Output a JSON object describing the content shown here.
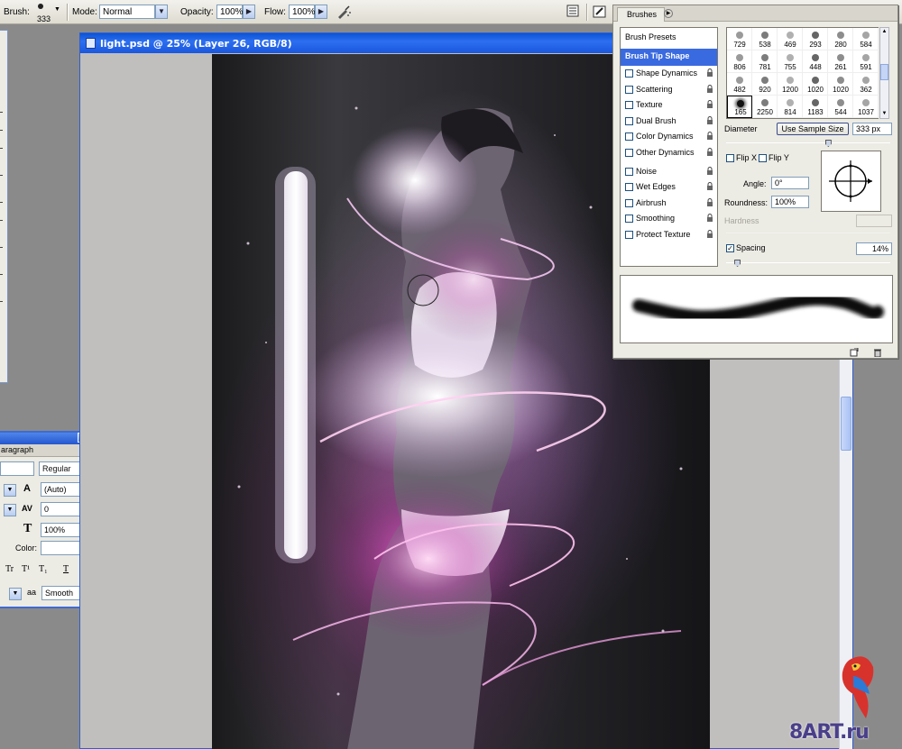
{
  "options_bar": {
    "brush_label": "Brush:",
    "brush_size": "333",
    "mode_label": "Mode:",
    "mode_value": "Normal",
    "opacity_label": "Opacity:",
    "opacity_value": "100%",
    "flow_label": "Flow:",
    "flow_value": "100%",
    "airbrush_icon": "airbrush-icon",
    "palette_icon": "palette-well-icon",
    "brush_panel_icon": "toggle-brushes-icon"
  },
  "paragraph_panel": {
    "tab_label": "aragraph",
    "font_style": "Regular",
    "leading": "(Auto)",
    "tracking": "0",
    "vertical_scale": "100%",
    "color_label": "Color:",
    "antialias": "Smooth",
    "antialias_prefix": "aa",
    "style_buttons": [
      "Tr",
      "T¹",
      "T₁",
      "T",
      "Ŧ"
    ]
  },
  "document": {
    "title": "light.psd @ 25% (Layer 26, RGB/8)"
  },
  "brushes_panel": {
    "tab_label": "Brushes",
    "options": [
      {
        "label": "Brush Presets",
        "type": "plain"
      },
      {
        "label": "Brush Tip Shape",
        "type": "selected"
      },
      {
        "label": "Shape Dynamics",
        "type": "check"
      },
      {
        "label": "Scattering",
        "type": "check"
      },
      {
        "label": "Texture",
        "type": "check"
      },
      {
        "label": "Dual Brush",
        "type": "check"
      },
      {
        "label": "Color Dynamics",
        "type": "check"
      },
      {
        "label": "Other Dynamics",
        "type": "check"
      },
      {
        "label": "Noise",
        "type": "check"
      },
      {
        "label": "Wet Edges",
        "type": "check"
      },
      {
        "label": "Airbrush",
        "type": "check"
      },
      {
        "label": "Smoothing",
        "type": "check"
      },
      {
        "label": "Protect Texture",
        "type": "check"
      }
    ],
    "tips": [
      "729",
      "538",
      "469",
      "293",
      "280",
      "584",
      "806",
      "781",
      "755",
      "448",
      "261",
      "591",
      "482",
      "920",
      "1200",
      "1020",
      "1020",
      "362",
      "165",
      "2250",
      "814",
      "1183",
      "544",
      "1037"
    ],
    "selected_tip": "165",
    "diameter_label": "Diameter",
    "use_sample_size": "Use Sample Size",
    "diameter_value": "333 px",
    "diameter_slider": 0.62,
    "flip_x": "Flip X",
    "flip_y": "Flip Y",
    "angle_label": "Angle:",
    "angle_value": "0°",
    "roundness_label": "Roundness:",
    "roundness_value": "100%",
    "hardness_label": "Hardness",
    "spacing_label": "Spacing",
    "spacing_checked": true,
    "spacing_value": "14%",
    "spacing_slider": 0.05
  },
  "watermark": "8ART.ru"
}
